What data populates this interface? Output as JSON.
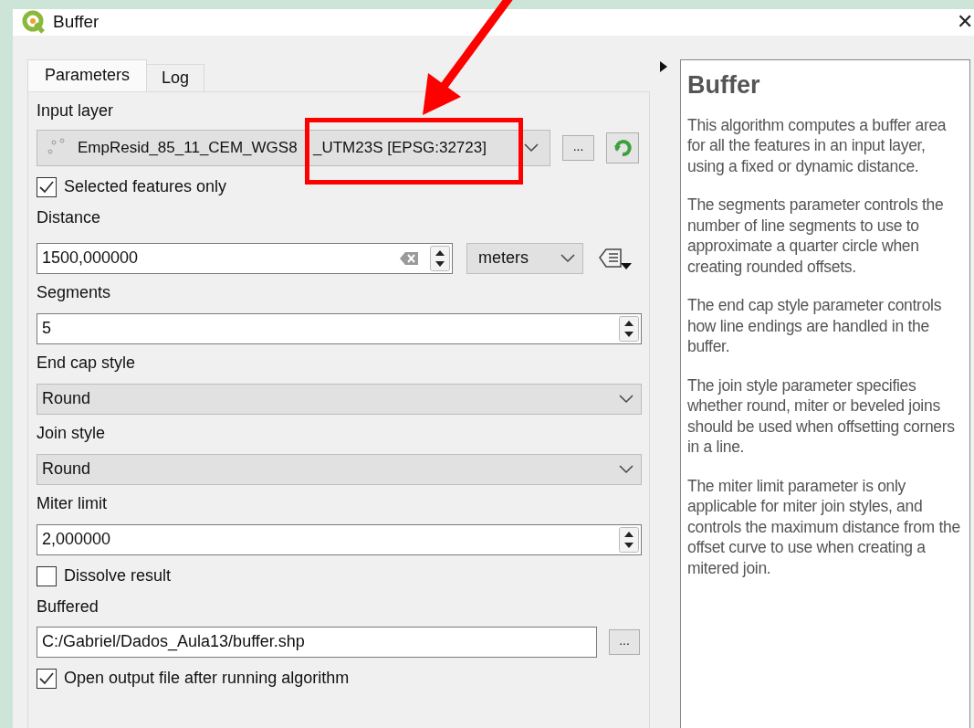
{
  "window": {
    "title": "Buffer",
    "close": "✕"
  },
  "tabs": [
    {
      "label": "Parameters",
      "selected": true
    },
    {
      "label": "Log",
      "selected": false
    }
  ],
  "params": [
    {
      "kind": "layer",
      "label": "Input layer",
      "value_before_mark": "EmpResid_85_11_CEM_WGS8",
      "value_after_mark": "_UTM23S [EPSG:32723]",
      "button": "..."
    },
    {
      "kind": "checkbox",
      "label": "Selected features only",
      "checked": true
    },
    {
      "kind": "distance",
      "label": "Distance",
      "value": "1500,000000",
      "unit": "meters"
    },
    {
      "kind": "spin",
      "label": "Segments",
      "value": "5"
    },
    {
      "kind": "combo",
      "label": "End cap style",
      "value": "Round"
    },
    {
      "kind": "combo",
      "label": "Join style",
      "value": "Round"
    },
    {
      "kind": "spin",
      "label": "Miter limit",
      "value": "2,000000"
    },
    {
      "kind": "checkbox",
      "label": "Dissolve result",
      "checked": false
    },
    {
      "kind": "file",
      "label": "Buffered",
      "value": "C:/Gabriel/Dados_Aula13/buffer.shp",
      "button": "..."
    },
    {
      "kind": "checkbox",
      "label": "Open output file after running algorithm",
      "checked": true
    }
  ],
  "help": {
    "title": "Buffer",
    "paragraphs": [
      "This algorithm computes a buffer area for all the features in an input layer, using a fixed or dynamic distance.",
      "The segments parameter controls the number of line segments to use to approximate a quarter circle when creating rounded offsets.",
      "The end cap style parameter controls how line endings are handled in the buffer.",
      "The join style parameter specifies whether round, miter or beveled joins should be used when offsetting corners in a line.",
      "The miter limit parameter is only applicable for miter join styles, and controls the maximum distance from the offset curve to use when creating a mitered join."
    ]
  }
}
